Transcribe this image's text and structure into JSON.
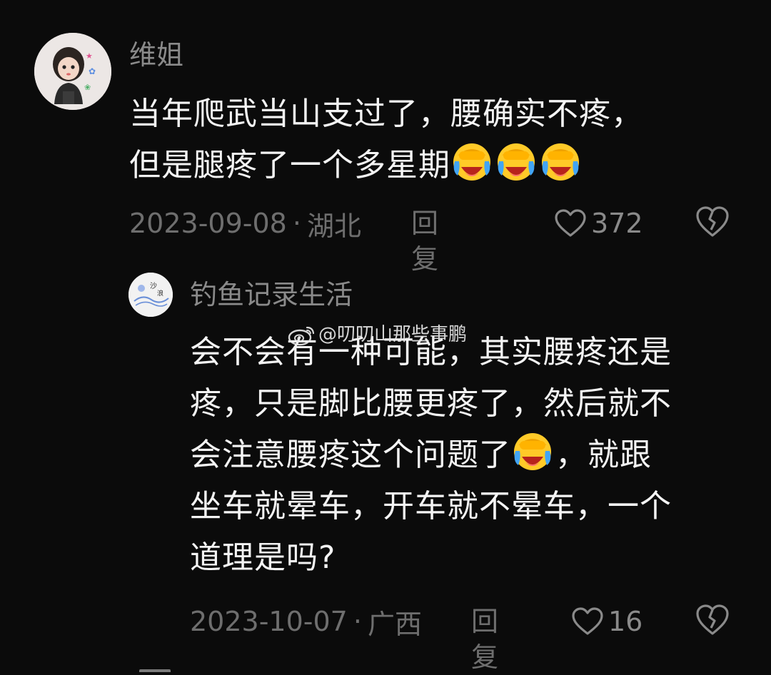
{
  "comments": [
    {
      "username": "维姐",
      "text_line1": "当年爬武当山支过了，腰确实不疼，",
      "text_line2": "但是腿疼了一个多星期",
      "emoji": "laughing-crying-emoji",
      "date": "2023-09-08",
      "separator": "·",
      "location": "湖北",
      "reply_label": "回复",
      "likes": "372"
    },
    {
      "username": "钓鱼记录生活",
      "text_line1": "会不会有一种可能，其实腰疼还是",
      "text_line2": "疼，只是脚比腰更疼了，然后就不",
      "text_line3a": "会注意腰疼这个问题了",
      "text_line3b": "，就跟",
      "text_line4": "坐车就晕车，开车就不晕车，一个",
      "text_line5": "道理是吗?",
      "emoji": "laughing-crying-emoji",
      "date": "2023-10-07",
      "separator": "·",
      "location": "广西",
      "reply_label": "回复",
      "likes": "16"
    }
  ],
  "watermark": {
    "text": "@叨叨山那些事鹏",
    "icon": "weibo-icon"
  },
  "colors": {
    "background": "#0b0b0b",
    "text": "#f4f4f4",
    "muted": "#6e6e6e",
    "username": "#8a8a8a"
  }
}
